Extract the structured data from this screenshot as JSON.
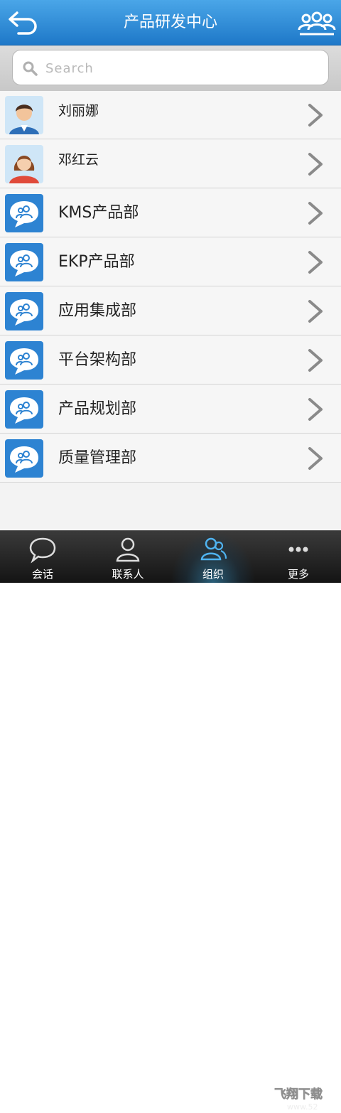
{
  "header": {
    "title": "产品研发中心"
  },
  "search": {
    "placeholder": "Search"
  },
  "items": [
    {
      "label": "刘丽娜",
      "type": "person-male"
    },
    {
      "label": "邓红云",
      "type": "person-female"
    },
    {
      "label": "KMS产品部",
      "type": "group"
    },
    {
      "label": "EKP产品部",
      "type": "group"
    },
    {
      "label": "应用集成部",
      "type": "group"
    },
    {
      "label": "平台架构部",
      "type": "group"
    },
    {
      "label": "产品规划部",
      "type": "group"
    },
    {
      "label": "质量管理部",
      "type": "group"
    }
  ],
  "tabs": [
    {
      "label": "会话",
      "icon": "chat-bubble-icon"
    },
    {
      "label": "联系人",
      "icon": "contact-person-icon"
    },
    {
      "label": "组织",
      "icon": "organization-icon",
      "active": true
    },
    {
      "label": "更多",
      "icon": "more-icon"
    }
  ],
  "watermark": {
    "text": "飞翔下载",
    "sub": "www.52"
  },
  "colors": {
    "header": "#2a86d4",
    "accent": "#2d83d2",
    "tabbar": "#1f1f1f"
  }
}
